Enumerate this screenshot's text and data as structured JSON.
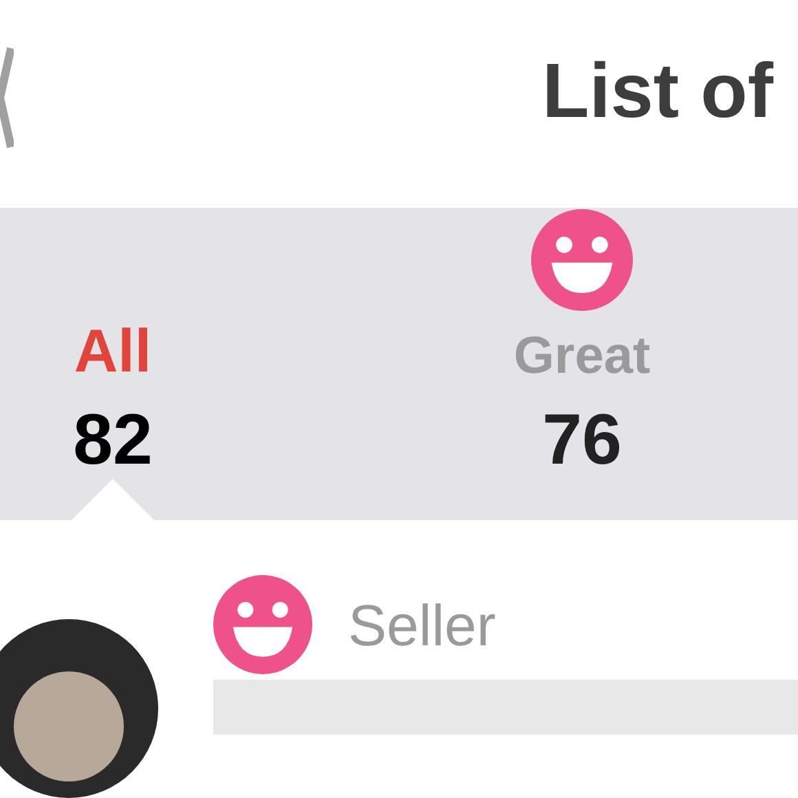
{
  "header": {
    "title": "List of"
  },
  "tabs": [
    {
      "kind": "plain",
      "label": "All",
      "count": "82",
      "selected": true
    },
    {
      "kind": "smiley",
      "label": "Great",
      "count": "76",
      "selected": false
    }
  ],
  "review": {
    "rating_label": "Seller"
  }
}
